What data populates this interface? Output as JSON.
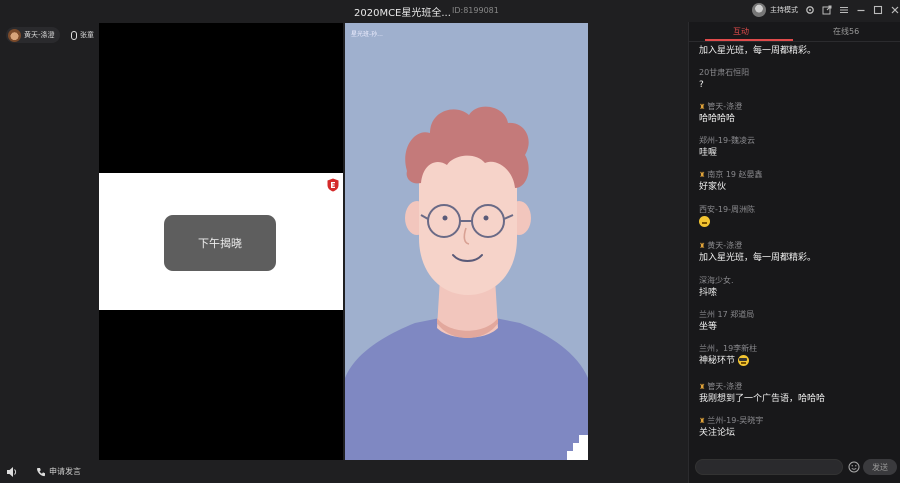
{
  "window": {
    "title": "2020MCE星光班全...",
    "room_id": "ID:8199081",
    "host_mode_label": "主持模式"
  },
  "participants": [
    {
      "name": "黄天-涤澄",
      "icon": "avatar"
    },
    {
      "name": "张童",
      "icon": "mic-icon"
    }
  ],
  "slide": {
    "button_label": "下午揭晓"
  },
  "camera": {
    "label": "星光班-孙..."
  },
  "bottom": {
    "apply_speak_label": "申请发言"
  },
  "chat": {
    "tabs": [
      {
        "label": "互动",
        "active": true
      },
      {
        "label": "在线56",
        "active": false
      }
    ],
    "messages": [
      {
        "name": "",
        "badge": false,
        "text": "加入星光班，每一周都精彩。"
      },
      {
        "name": "20甘肃石恒阳",
        "badge": false,
        "text": "?"
      },
      {
        "name": "管天-涤澄",
        "badge": true,
        "text": "哈哈哈哈"
      },
      {
        "name": "郑州-19-魏凌云",
        "badge": false,
        "text": "哇喔"
      },
      {
        "name": "南京 19 赵晏鑫",
        "badge": true,
        "text": "好家伙"
      },
      {
        "name": "西安-19-周洲陈",
        "badge": false,
        "text": "",
        "emoji": "thinking"
      },
      {
        "name": "黄天-涤澄",
        "badge": true,
        "text": "加入星光班，每一周都精彩。"
      },
      {
        "name": "深海少女.",
        "badge": false,
        "text": "抖嗦"
      },
      {
        "name": "兰州 17 郑道局",
        "badge": false,
        "text": "坐等"
      },
      {
        "name": "兰州，19李新柱",
        "badge": false,
        "text": "神秘环节",
        "emoji": "cool"
      },
      {
        "name": "管天-涤澄",
        "badge": true,
        "text": "我刚想到了一个广告语，哈哈哈"
      },
      {
        "name": "兰州-19-吴晓宇",
        "badge": true,
        "text": "关注论坛"
      }
    ],
    "input_placeholder": "",
    "send_label": "发送"
  }
}
